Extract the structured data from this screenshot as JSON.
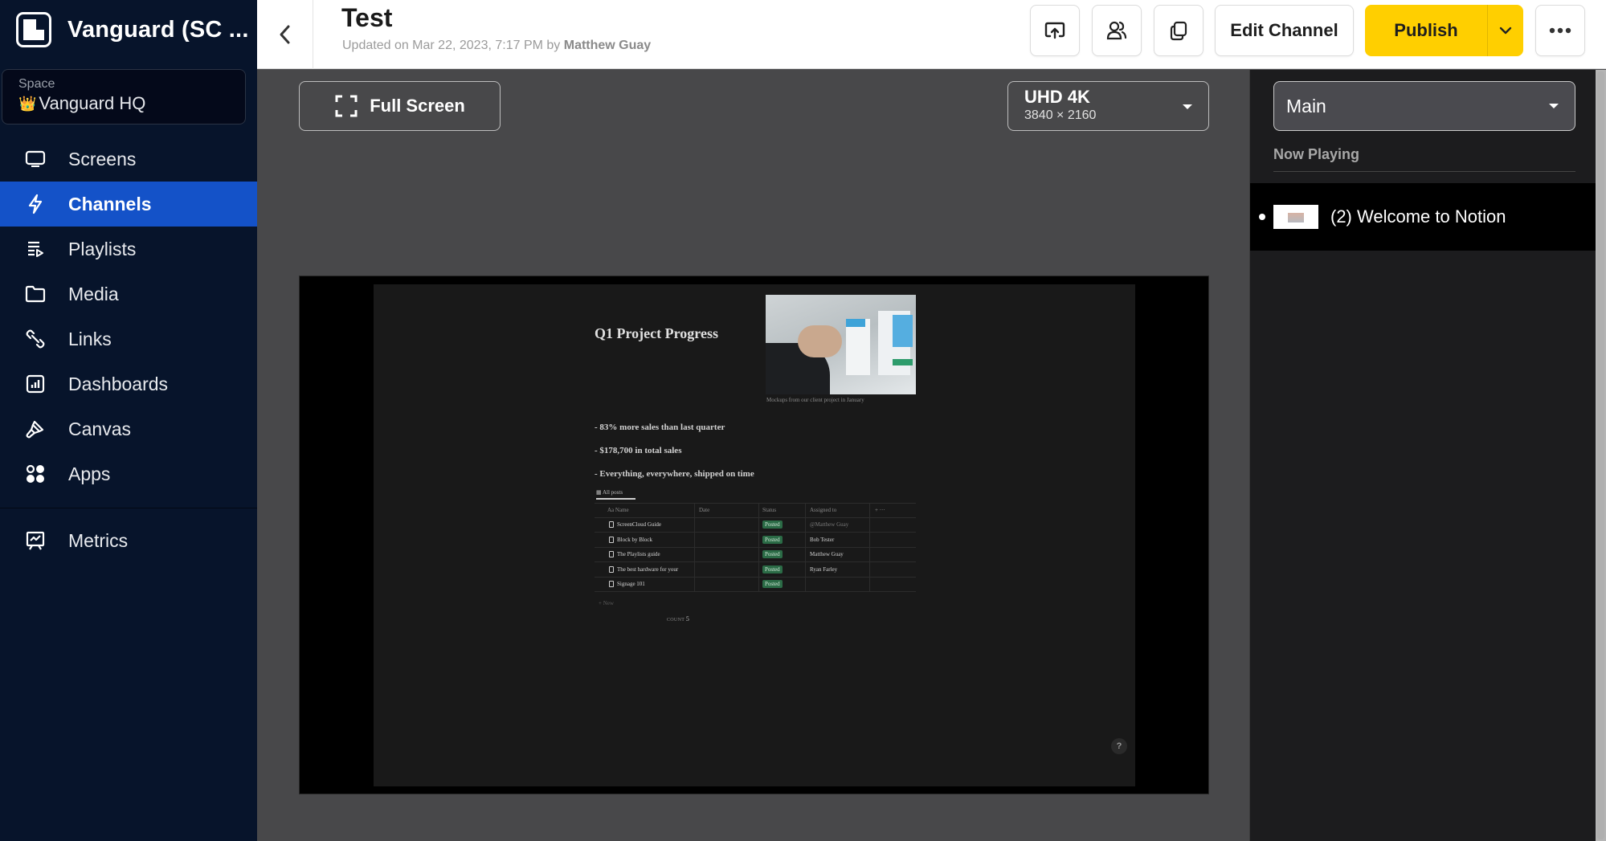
{
  "sidebar": {
    "brand": "Vanguard (SC ...",
    "space": {
      "label": "Space",
      "emoji": "👑",
      "name": "Vanguard HQ"
    },
    "items": [
      {
        "label": "Screens",
        "icon": "screen-icon",
        "active": false
      },
      {
        "label": "Channels",
        "icon": "lightning-icon",
        "active": true
      },
      {
        "label": "Playlists",
        "icon": "playlist-icon",
        "active": false
      },
      {
        "label": "Media",
        "icon": "folder-icon",
        "active": false
      },
      {
        "label": "Links",
        "icon": "link-icon",
        "active": false
      },
      {
        "label": "Dashboards",
        "icon": "dashboard-icon",
        "active": false
      },
      {
        "label": "Canvas",
        "icon": "brush-icon",
        "active": false
      },
      {
        "label": "Apps",
        "icon": "apps-icon",
        "active": false
      }
    ],
    "bottom_items": [
      {
        "label": "Metrics",
        "icon": "metrics-icon"
      }
    ]
  },
  "header": {
    "title": "Test",
    "updated_prefix": "Updated on Mar 22, 2023, 7:17 PM by ",
    "updated_by": "Matthew Guay",
    "edit_label": "Edit Channel",
    "publish_label": "Publish",
    "icons": [
      "share-icon",
      "users-icon",
      "duplicate-icon",
      "more-icon"
    ]
  },
  "preview": {
    "fullscreen_label": "Full Screen",
    "resolution": {
      "name": "UHD 4K",
      "dims": "3840 × 2160"
    },
    "slide": {
      "title": "Q1 Project Progress",
      "caption": "Mockups from our client project in January",
      "bullets": [
        "- 83% more sales than last quarter",
        "- $178,700 in total sales",
        "- Everything, everywhere, shipped on time"
      ],
      "tab": "All posts",
      "table": {
        "headers": {
          "name": "Aa Name",
          "date": "Date",
          "status": "Status",
          "assigned": "Assigned to",
          "add": "+  ···"
        },
        "rows": [
          {
            "name": "ScreenCloud Guide",
            "status": "Posted",
            "assigned": "@Matthew Guay"
          },
          {
            "name": "Block by Block",
            "status": "Posted",
            "assigned": "Bob Tester"
          },
          {
            "name": "The Playlists guide",
            "status": "Posted",
            "assigned": "Matthew Guay"
          },
          {
            "name": "The best hardware for your",
            "status": "Posted",
            "assigned": "Ryan Farley"
          },
          {
            "name": "Signage 101",
            "status": "Posted",
            "assigned": ""
          }
        ],
        "new_label": "+ New",
        "count_label": "COUNT",
        "count_value": "5"
      },
      "help": "?"
    }
  },
  "right_panel": {
    "zone": "Main",
    "now_playing_label": "Now Playing",
    "items": [
      {
        "title": "(2) Welcome to Notion"
      }
    ]
  },
  "colors": {
    "sidebar_bg": "#07142b",
    "active_nav": "#1452c8",
    "publish": "#ffcf00",
    "posted_badge": "#2b6b46"
  }
}
